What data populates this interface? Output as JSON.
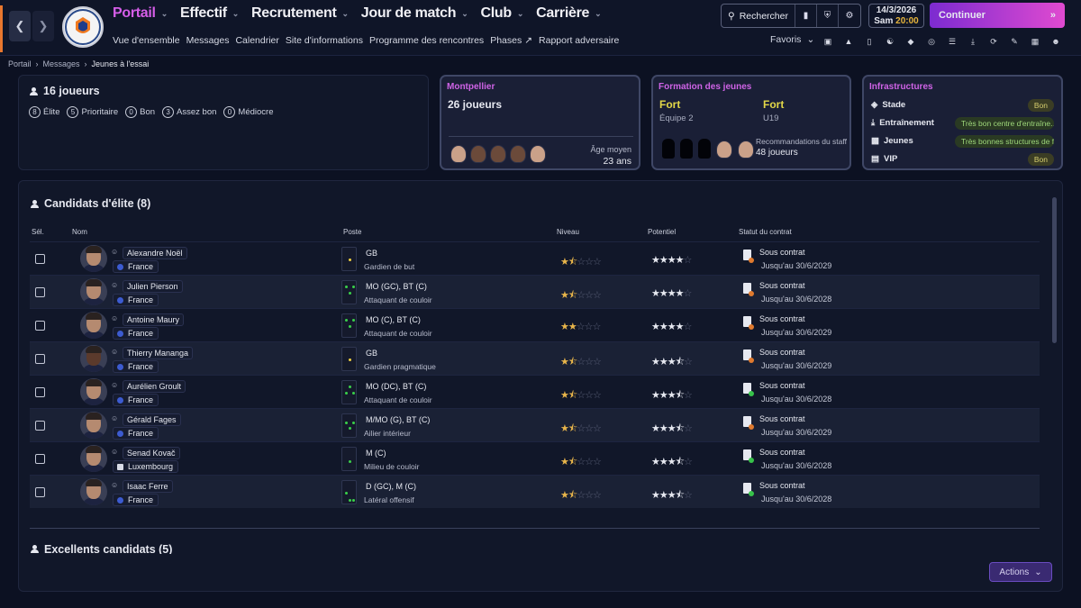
{
  "menu": [
    {
      "label": "Portail"
    },
    {
      "label": "Effectif"
    },
    {
      "label": "Recrutement"
    },
    {
      "label": "Jour de match"
    },
    {
      "label": "Club"
    },
    {
      "label": "Carrière"
    }
  ],
  "submenu": [
    "Vue d'ensemble",
    "Messages",
    "Calendrier",
    "Site d'informations",
    "Programme des rencontres",
    "Phases",
    "Rapport adversaire"
  ],
  "search_label": "Rechercher",
  "date": "14/3/2026",
  "day": "Sam",
  "time": "20:00",
  "continue_label": "Continuer",
  "favorites_label": "Favoris",
  "breadcrumb": [
    "Portail",
    "Messages",
    "Jeunes à l'essai"
  ],
  "summary": {
    "title": "16 joueurs",
    "pills": [
      {
        "n": "8",
        "label": "Élite"
      },
      {
        "n": "5",
        "label": "Prioritaire"
      },
      {
        "n": "0",
        "label": "Bon"
      },
      {
        "n": "3",
        "label": "Assez bon"
      },
      {
        "n": "0",
        "label": "Médiocre"
      }
    ]
  },
  "club_card": {
    "title": "Montpellier",
    "players": "26 joueurs",
    "age_label": "Âge moyen",
    "age_value": "23 ans"
  },
  "youth_card": {
    "title": "Formation des jeunes",
    "col1_value": "Fort",
    "col1_sub": "Équipe 2",
    "col2_value": "Fort",
    "col2_sub": "U19",
    "rec_label": "Recommandations du staff",
    "rec_value": "48 joueurs"
  },
  "infra_card": {
    "title": "Infrastructures",
    "rows": [
      {
        "label": "Stade",
        "value": "Bon"
      },
      {
        "label": "Entraînement",
        "value": "Très bon centre d'entraîne..."
      },
      {
        "label": "Jeunes",
        "value": "Très bonnes structures de f..."
      },
      {
        "label": "VIP",
        "value": "Bon"
      }
    ]
  },
  "section_title": "Candidats d'élite (8)",
  "section2_title": "Excellents candidats (5)",
  "columns": {
    "sel": "Sél.",
    "name": "Nom",
    "pos": "Poste",
    "level": "Niveau",
    "pot": "Potentiel",
    "contract": "Statut du contrat"
  },
  "players": [
    {
      "name": "Alexandre Noël",
      "nation": "France",
      "pos": "GB",
      "role": "Gardien de but",
      "level": 1.5,
      "pot": 4,
      "contract": "Sous contrat",
      "until": "Jusqu'au 30/6/2029"
    },
    {
      "name": "Julien Pierson",
      "nation": "France",
      "pos": "MO (GC), BT (C)",
      "role": "Attaquant de couloir",
      "level": 1.5,
      "pot": 4,
      "contract": "Sous contrat",
      "until": "Jusqu'au 30/6/2028"
    },
    {
      "name": "Antoine Maury",
      "nation": "France",
      "pos": "MO (C), BT (C)",
      "role": "Attaquant de couloir",
      "level": 2,
      "pot": 4,
      "contract": "Sous contrat",
      "until": "Jusqu'au 30/6/2029"
    },
    {
      "name": "Thierry Mananga",
      "nation": "France",
      "pos": "GB",
      "role": "Gardien pragmatique",
      "level": 1.5,
      "pot": 3.5,
      "contract": "Sous contrat",
      "until": "Jusqu'au 30/6/2029"
    },
    {
      "name": "Aurélien Groult",
      "nation": "France",
      "pos": "MO (DC), BT (C)",
      "role": "Attaquant de couloir",
      "level": 1.5,
      "pot": 3.5,
      "contract": "Sous contrat",
      "until": "Jusqu'au 30/6/2028"
    },
    {
      "name": "Gérald Fages",
      "nation": "France",
      "pos": "M/MO (G), BT (C)",
      "role": "Ailier intérieur",
      "level": 1.5,
      "pot": 3.5,
      "contract": "Sous contrat",
      "until": "Jusqu'au 30/6/2029"
    },
    {
      "name": "Senad Kovač",
      "nation": "Luxembourg",
      "pos": "M (C)",
      "role": "Milieu de couloir",
      "level": 1.5,
      "pot": 3.5,
      "contract": "Sous contrat",
      "until": "Jusqu'au 30/6/2028"
    },
    {
      "name": "Isaac Ferre",
      "nation": "France",
      "pos": "D (GC), M (C)",
      "role": "Latéral offensif",
      "level": 1.5,
      "pot": 3.5,
      "contract": "Sous contrat",
      "until": "Jusqu'au 30/6/2028"
    }
  ],
  "actions_label": "Actions",
  "colors": {
    "accent": "#d55ee8",
    "gold": "#e8b54a",
    "fort": "#e3d848"
  }
}
